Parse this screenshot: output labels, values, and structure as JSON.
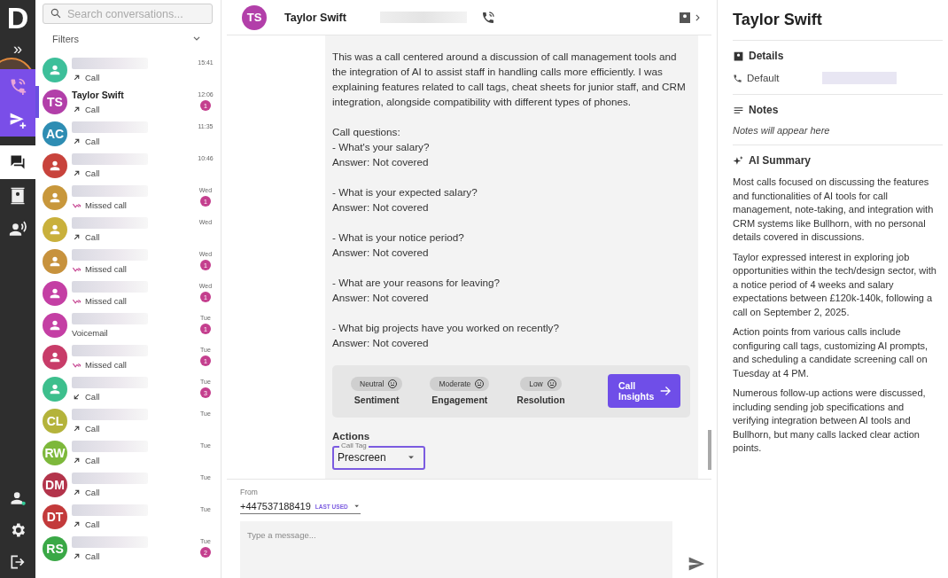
{
  "rail": {
    "logo": "D",
    "expand": "»",
    "items": [
      {
        "kind": "new-call",
        "selected": false,
        "highlighted": true
      },
      {
        "kind": "new-message",
        "selected": false
      },
      {
        "kind": "conversations",
        "selected": true
      },
      {
        "kind": "contacts",
        "selected": false
      },
      {
        "kind": "voice",
        "selected": false
      }
    ],
    "bottom_items": [
      {
        "kind": "status"
      },
      {
        "kind": "settings"
      },
      {
        "kind": "logout"
      }
    ]
  },
  "conversation_list": {
    "search": {
      "placeholder": "Search conversations..."
    },
    "filters": "Filters",
    "conversations": [
      {
        "color": "#3dbf9a",
        "name_blurred": true,
        "kind": "outgoing",
        "label": "Call",
        "time": "15:41",
        "selected": false
      },
      {
        "avatar": "TS",
        "color": "#b23fa9",
        "name": "Taylor Swift",
        "kind": "outgoing",
        "label": "Call",
        "time": "12:06",
        "unread": "1",
        "selected": true
      },
      {
        "avatar": "AC",
        "color": "#2e8db3",
        "name_blurred": true,
        "kind": "outgoing",
        "label": "Call",
        "time": "11:35",
        "selected": false
      },
      {
        "color": "#c8433c",
        "name_blurred": true,
        "kind": "outgoing",
        "label": "Call",
        "time": "10:46",
        "selected": false
      },
      {
        "color": "#c8973b",
        "name_blurred": true,
        "kind": "missed",
        "label": "Missed call",
        "time": "Wed",
        "unread": "1",
        "selected": false
      },
      {
        "color": "#c9b03c",
        "name_blurred": true,
        "kind": "outgoing",
        "label": "Call",
        "time": "Wed",
        "selected": false
      },
      {
        "color": "#c7923d",
        "name_blurred": true,
        "kind": "missed",
        "label": "Missed call",
        "time": "Wed",
        "unread": "1",
        "selected": false
      },
      {
        "color": "#c43fa4",
        "name_blurred": true,
        "kind": "missed",
        "label": "Missed call",
        "time": "Wed",
        "unread": "1",
        "selected": false
      },
      {
        "color": "#c43fa4",
        "name_blurred": true,
        "kind": "voicemail",
        "label": "Voicemail",
        "time": "Tue",
        "unread": "1",
        "selected": false
      },
      {
        "color": "#c83c69",
        "name_blurred": true,
        "kind": "missed",
        "label": "Missed call",
        "time": "Tue",
        "unread": "1",
        "selected": false
      },
      {
        "color": "#3dbf8d",
        "name_blurred": true,
        "kind": "incoming",
        "label": "Call",
        "time": "Tue",
        "unread": "3",
        "selected": false
      },
      {
        "avatar": "CL",
        "color": "#b4b33b",
        "name_blurred": true,
        "kind": "outgoing",
        "label": "Call",
        "time": "Tue",
        "selected": false
      },
      {
        "avatar": "RW",
        "color": "#7db83b",
        "name_blurred": true,
        "kind": "outgoing",
        "label": "Call",
        "time": "Tue",
        "selected": false
      },
      {
        "avatar": "DM",
        "color": "#b3344b",
        "name_blurred": true,
        "kind": "outgoing",
        "label": "Call",
        "time": "Tue",
        "selected": false
      },
      {
        "avatar": "DT",
        "color": "#c33a3b",
        "name_blurred": true,
        "kind": "outgoing",
        "label": "Call",
        "time": "Tue",
        "selected": false
      },
      {
        "avatar": "RS",
        "color": "#3aa846",
        "name_blurred": true,
        "kind": "outgoing",
        "label": "Call",
        "time": "Tue",
        "unread": "2",
        "selected": false
      }
    ]
  },
  "conversation": {
    "header": {
      "avatar": "TS",
      "color": "#b23fa9",
      "name": "Taylor Swift",
      "number_blurred": true
    },
    "call_notes": {
      "summary": "This was a call centered around a discussion of call management tools and the integration of AI to assist staff in handling calls more efficiently. I was explaining features related to call tags, cheat sheets for junior staff, and CRM integration, alongside compatibility with different types of phones.",
      "questions_heading": "Call questions:",
      "questions": [
        {
          "question": "- What's your salary?",
          "answer": "Answer: Not covered"
        },
        {
          "question": "- What is your expected salary?",
          "answer": "Answer: Not covered"
        },
        {
          "question": "- What is your notice period?",
          "answer": "Answer: Not covered"
        },
        {
          "question": "- What are your reasons for leaving?",
          "answer": "Answer: Not covered"
        },
        {
          "question": "- What big projects have you worked on recently?",
          "answer": "Answer: Not covered"
        }
      ]
    },
    "metrics": [
      {
        "value": "Neutral",
        "label": "Sentiment"
      },
      {
        "value": "Moderate",
        "label": "Engagement"
      },
      {
        "value": "Low",
        "label": "Resolution"
      }
    ],
    "insights_button": "Call Insights",
    "actions": {
      "title": "Actions",
      "call_tag": {
        "label": "Call Tag",
        "value": "Prescreen"
      }
    },
    "composer": {
      "from_label": "From",
      "number": "+447537188419",
      "badge": "LAST USED",
      "placeholder": "Type a message..."
    }
  },
  "contact_panel": {
    "title": "Taylor Swift",
    "details": {
      "title": "Details",
      "phone_label": "Default",
      "phone_blurred": true
    },
    "notes": {
      "title": "Notes",
      "empty": "Notes will appear here"
    },
    "ai_summary": {
      "title": "AI Summary",
      "paragraphs": [
        "Most calls focused on discussing the features and functionalities of AI tools for call management, note-taking, and integration with CRM systems like Bullhorn, with no personal details covered in discussions.",
        "Taylor expressed interest in exploring job opportunities within the tech/design sector, with a notice period of 4 weeks and salary expectations between £120k-140k, following a call on September 2, 2025.",
        "Action points from various calls include configuring call tags, customizing AI prompts, and scheduling a candidate screening call on Tuesday at 4 PM.",
        "Numerous follow-up actions were discussed, including sending job specifications and verifying integration between AI tools and Bullhorn, but many calls lacked clear action points."
      ]
    }
  }
}
